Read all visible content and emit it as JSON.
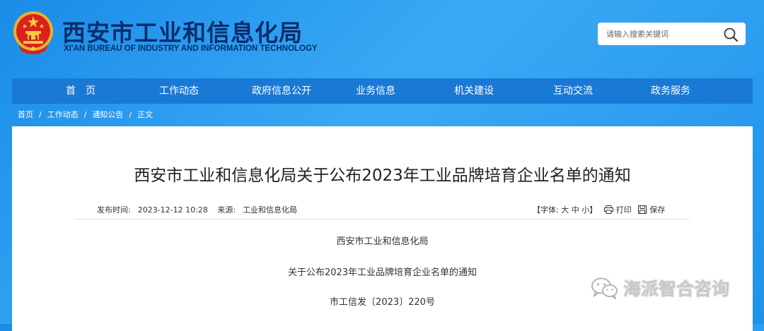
{
  "header": {
    "title": "西安市工业和信息化局",
    "subtitle": "XI'AN BUREAU OF INDUSTRY AND INFORMATION TECHNOLOGY",
    "emblem_icon": "national-emblem-icon"
  },
  "search": {
    "placeholder": "请输入搜索关键词",
    "icon": "search-icon"
  },
  "nav": {
    "items": [
      {
        "label": "首　页"
      },
      {
        "label": "工作动态"
      },
      {
        "label": "政府信息公开"
      },
      {
        "label": "业务信息"
      },
      {
        "label": "机关建设"
      },
      {
        "label": "互动交流"
      },
      {
        "label": "政务服务"
      }
    ]
  },
  "breadcrumb": {
    "items": [
      "首页",
      "工作动态",
      "通知公告",
      "正文"
    ],
    "separator": "/"
  },
  "article": {
    "title": "西安市工业和信息化局关于公布2023年工业品牌培育企业名单的通知",
    "publish_label": "发布时间:",
    "publish_time": "2023-12-12 10:28",
    "source_label": "来源:",
    "source": "工业和信息化局",
    "font_size_label": "【字体:",
    "font_large": "大",
    "font_medium": "中",
    "font_small": "小】",
    "print_label": "打印",
    "save_label": "保存",
    "body": [
      "西安市工业和信息化局",
      "关于公布2023年工业品牌培育企业名单的通知",
      "市工信发〔2023〕220号"
    ]
  },
  "watermark": {
    "text": "海派智合咨询"
  },
  "colors": {
    "background": "#1f92ea",
    "nav": "#1a79d4",
    "title": "#0b2d6b"
  }
}
